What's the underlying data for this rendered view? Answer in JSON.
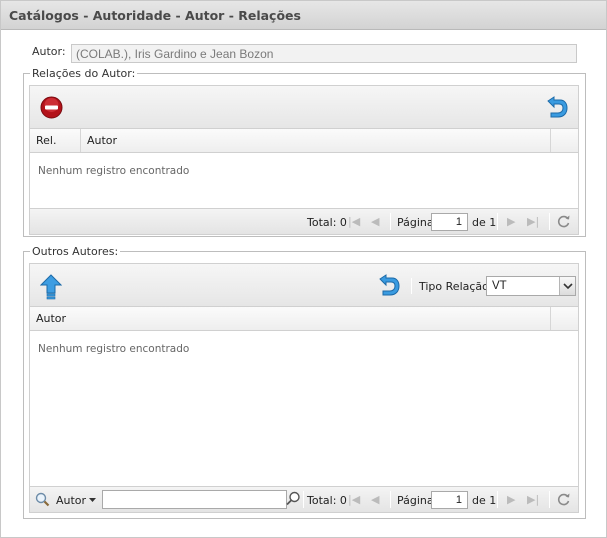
{
  "window": {
    "title": "Catálogos - Autoridade - Autor - Relações"
  },
  "author": {
    "label": "Autor:",
    "value": "(COLAB.), Iris Gardino e Jean Bozon"
  },
  "relations": {
    "legend": "Relações do Autor:",
    "columns": [
      "Rel.",
      "Autor"
    ],
    "empty_message": "Nenhum registro encontrado",
    "pager": {
      "total_label": "Total: 0",
      "page_label": "Página",
      "page_value": "1",
      "of_label": "de 1"
    }
  },
  "others": {
    "legend": "Outros Autores:",
    "relation_type_label": "Tipo Relação:",
    "relation_type_value": "VT",
    "columns": [
      "Autor"
    ],
    "empty_message": "Nenhum registro encontrado",
    "search": {
      "field_label": "Autor",
      "value": ""
    },
    "pager": {
      "total_label": "Total: 0",
      "page_label": "Página",
      "page_value": "1",
      "of_label": "de 1"
    }
  },
  "icons": {
    "remove": "remove-icon",
    "back": "undo-arrow-icon",
    "move_up": "up-arrow-icon",
    "search": "magnifier-icon",
    "first": "first-page-icon",
    "prev": "prev-page-icon",
    "next": "next-page-icon",
    "last": "last-page-icon",
    "refresh": "refresh-icon"
  },
  "colors": {
    "title_bg": "#dcdcdc",
    "toolbar_bg": "#ececec",
    "accent_blue": "#2f8fd6",
    "remove_red": "#c0151b"
  }
}
